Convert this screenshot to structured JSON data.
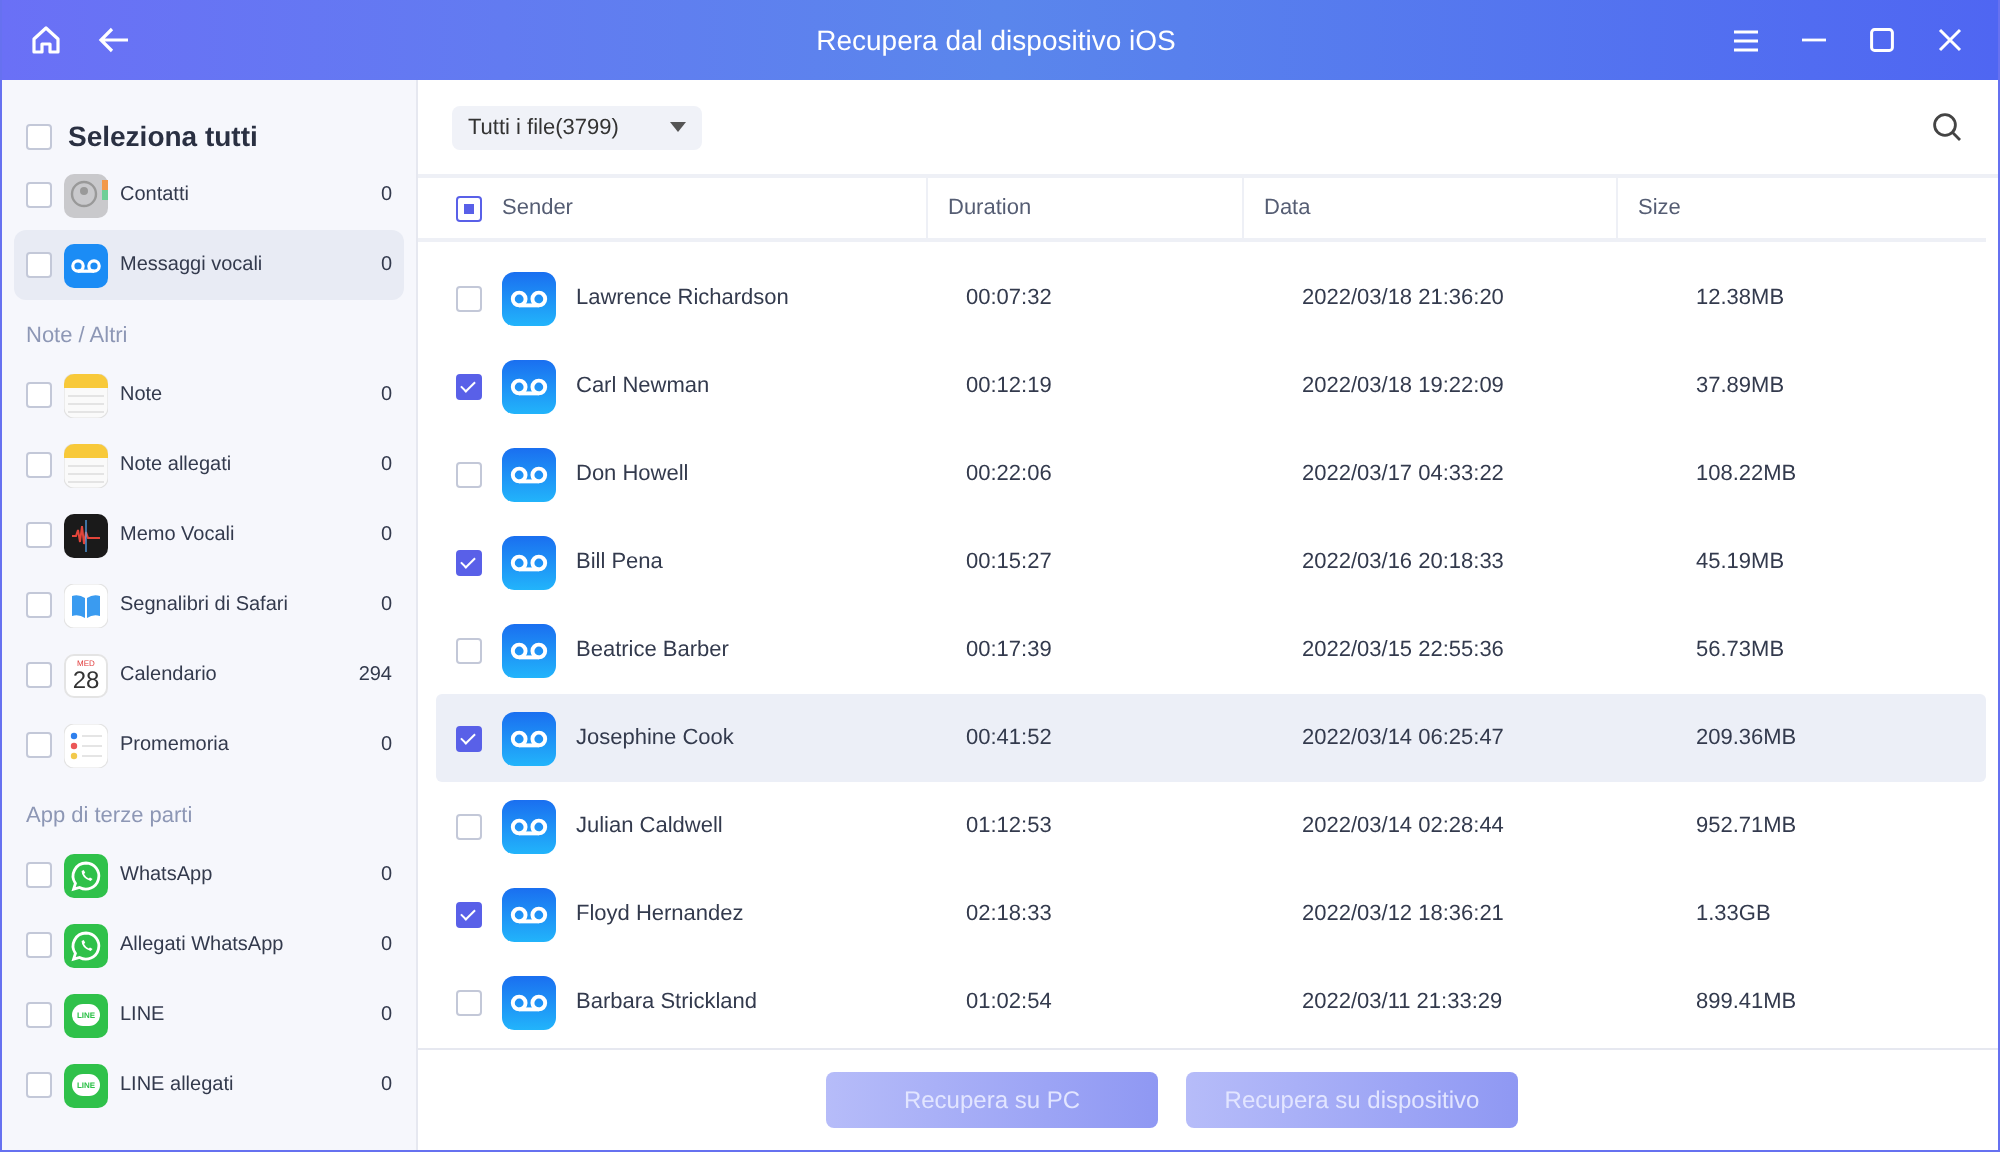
{
  "window": {
    "title": "Recupera dal dispositivo iOS"
  },
  "sidebar": {
    "select_all": {
      "label": "Seleziona tutti",
      "checked": false
    },
    "groups": [
      {
        "items": [
          {
            "label": "Contatti",
            "count": "0",
            "kind": "contacts",
            "checked": false,
            "selected": false
          },
          {
            "label": "Messaggi vocali",
            "count": "0",
            "kind": "voicemail",
            "checked": false,
            "selected": true
          }
        ]
      },
      {
        "title": "Note / Altri",
        "items": [
          {
            "label": "Note",
            "count": "0",
            "kind": "notes",
            "checked": false,
            "selected": false
          },
          {
            "label": "Note allegati",
            "count": "0",
            "kind": "notes",
            "checked": false,
            "selected": false
          },
          {
            "label": "Memo Vocali",
            "count": "0",
            "kind": "memo",
            "checked": false,
            "selected": false
          },
          {
            "label": "Segnalibri di Safari",
            "count": "0",
            "kind": "bookmarks",
            "checked": false,
            "selected": false
          },
          {
            "label": "Calendario",
            "count": "294",
            "kind": "calendar",
            "icon_day": "MED",
            "icon_date": "28",
            "checked": false,
            "selected": false
          },
          {
            "label": "Promemoria",
            "count": "0",
            "kind": "reminders",
            "checked": false,
            "selected": false
          }
        ]
      },
      {
        "title": "App di terze parti",
        "items": [
          {
            "label": "WhatsApp",
            "count": "0",
            "kind": "whatsapp",
            "checked": false,
            "selected": false
          },
          {
            "label": "Allegati WhatsApp",
            "count": "0",
            "kind": "whatsapp",
            "checked": false,
            "selected": false
          },
          {
            "label": "LINE",
            "count": "0",
            "kind": "line",
            "icon_text": "LINE",
            "checked": false,
            "selected": false
          },
          {
            "label": "LINE allegati",
            "count": "0",
            "kind": "line",
            "icon_text": "LINE",
            "checked": false,
            "selected": false
          }
        ]
      }
    ]
  },
  "filter": {
    "value": "Tutti i file(3799)"
  },
  "table": {
    "header_checkbox_partial": true,
    "columns": [
      "Sender",
      "Duration",
      "Data",
      "Size"
    ],
    "rows": [
      {
        "sender": "Lawrence Richardson",
        "duration": "00:07:32",
        "date": "2022/03/18 21:36:20",
        "size": "12.38MB",
        "checked": false,
        "selected": false
      },
      {
        "sender": "Carl Newman",
        "duration": "00:12:19",
        "date": "2022/03/18 19:22:09",
        "size": "37.89MB",
        "checked": true,
        "selected": false
      },
      {
        "sender": "Don Howell",
        "duration": "00:22:06",
        "date": "2022/03/17 04:33:22",
        "size": "108.22MB",
        "checked": false,
        "selected": false
      },
      {
        "sender": "Bill Pena",
        "duration": "00:15:27",
        "date": "2022/03/16 20:18:33",
        "size": "45.19MB",
        "checked": true,
        "selected": false
      },
      {
        "sender": "Beatrice Barber",
        "duration": "00:17:39",
        "date": "2022/03/15 22:55:36",
        "size": "56.73MB",
        "checked": false,
        "selected": false
      },
      {
        "sender": "Josephine Cook",
        "duration": "00:41:52",
        "date": "2022/03/14 06:25:47",
        "size": "209.36MB",
        "checked": true,
        "selected": true
      },
      {
        "sender": "Julian Caldwell",
        "duration": "01:12:53",
        "date": "2022/03/14 02:28:44",
        "size": "952.71MB",
        "checked": false,
        "selected": false
      },
      {
        "sender": "Floyd Hernandez",
        "duration": "02:18:33",
        "date": "2022/03/12 18:36:21",
        "size": "1.33GB",
        "checked": true,
        "selected": false
      },
      {
        "sender": "Barbara Strickland",
        "duration": "01:02:54",
        "date": "2022/03/11 21:33:29",
        "size": "899.41MB",
        "checked": false,
        "selected": false
      }
    ]
  },
  "buttons": [
    {
      "label": "Recupera su PC",
      "disabled": true
    },
    {
      "label": "Recupera su dispositivo",
      "disabled": true
    }
  ]
}
